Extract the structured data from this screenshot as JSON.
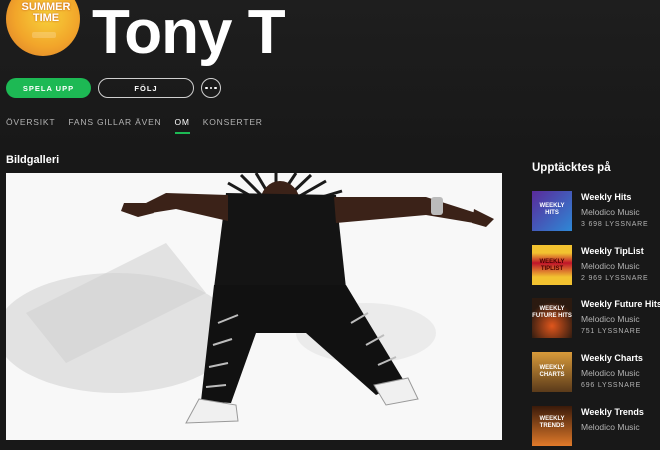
{
  "artist": {
    "name": "Tony T",
    "avatar_text": "SUMMER TIME"
  },
  "actions": {
    "play_label": "SPELA UPP",
    "follow_label": "FÖLJ",
    "more_icon": "more-icon"
  },
  "tabs": [
    {
      "label": "ÖVERSIKT",
      "active": false
    },
    {
      "label": "FANS GILLAR ÄVEN",
      "active": false
    },
    {
      "label": "OM",
      "active": true
    },
    {
      "label": "KONSERTER",
      "active": false
    }
  ],
  "gallery": {
    "title": "Bildgalleri"
  },
  "sidebar": {
    "title": "Upptäcktes på",
    "playlists": [
      {
        "name": "Weekly Hits",
        "owner": "Melodico Music",
        "listeners": "3 698 LYSSNARE",
        "thumb_text": "WEEKLY HITS",
        "colors": [
          "#5a2a9a",
          "#2e88d6"
        ]
      },
      {
        "name": "Weekly TipList",
        "owner": "Melodico Music",
        "listeners": "2 969 LYSSNARE",
        "thumb_text": "WEEKLY TIPLIST",
        "colors": [
          "#f2c230",
          "#c0142a"
        ]
      },
      {
        "name": "Weekly Future Hits",
        "owner": "Melodico Music",
        "listeners": "751 LYSSNARE",
        "thumb_text": "WEEKLY FUTURE HITS",
        "colors": [
          "#2b1a10",
          "#e0561c"
        ]
      },
      {
        "name": "Weekly Charts",
        "owner": "Melodico Music",
        "listeners": "696 LYSSNARE",
        "thumb_text": "WEEKLY CHARTS",
        "colors": [
          "#5a3a1a",
          "#d89a3a"
        ]
      },
      {
        "name": "Weekly Trends",
        "owner": "Melodico Music",
        "listeners": "",
        "thumb_text": "WEEKLY TRENDS",
        "colors": [
          "#3a1a0a",
          "#e07a2a"
        ]
      }
    ]
  },
  "colors": {
    "accent": "#1db954",
    "background": "#181818",
    "muted_text": "#b3b3b3"
  }
}
